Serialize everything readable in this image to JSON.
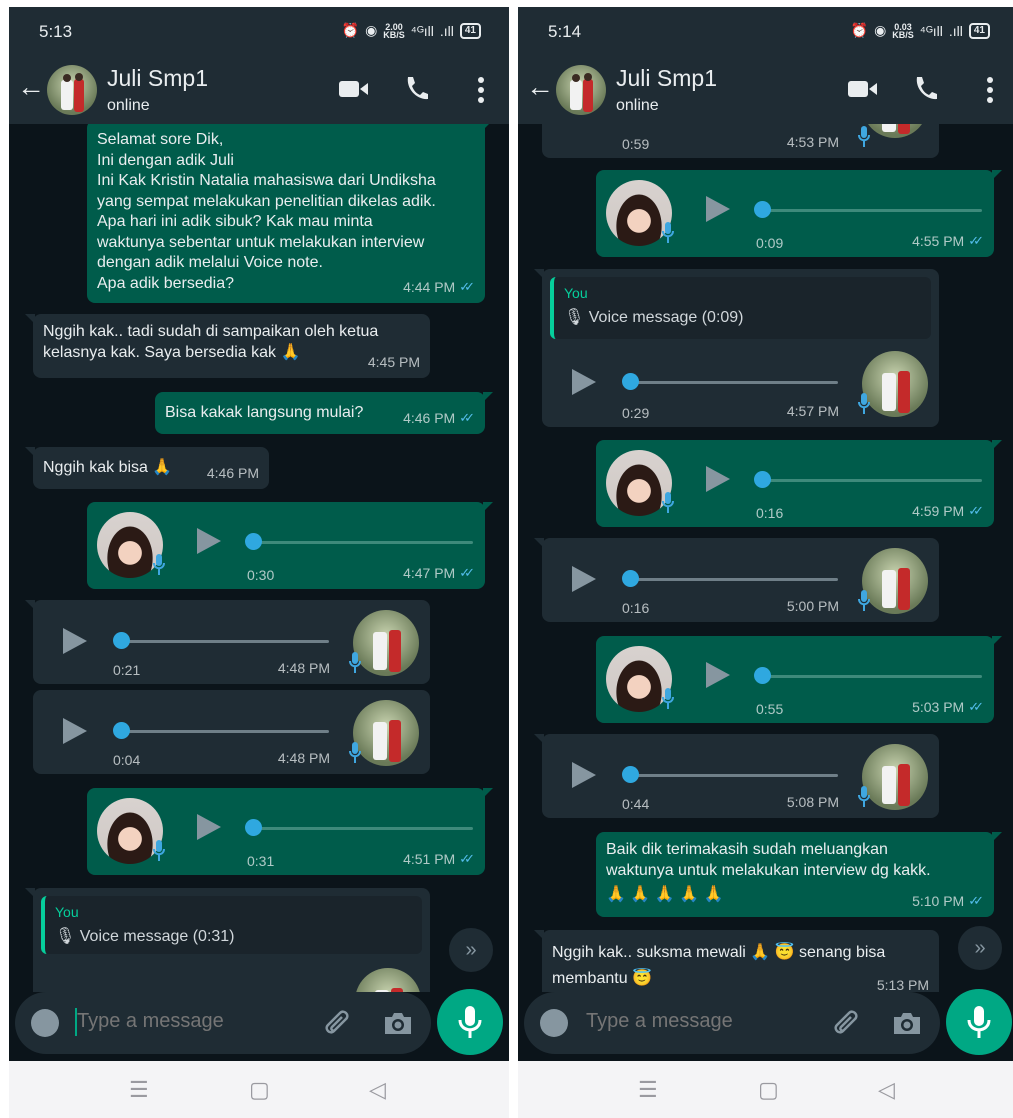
{
  "screens": [
    {
      "status": {
        "time": "5:13",
        "speed_top": "2.00",
        "speed_unit": "KB/S",
        "battery": "41"
      },
      "header": {
        "name": "Juli Smp1",
        "status": "online"
      },
      "messages": [
        {
          "type": "text",
          "dir": "out",
          "lines": [
            "Selamat sore Dik,",
            "Ini dengan adik Juli",
            "Ini Kak Kristin Natalia mahasiswa dari Undiksha",
            "yang sempat melakukan penelitian dikelas adik.",
            "Apa hari ini adik sibuk? Kak mau minta",
            "waktunya sebentar untuk melakukan interview",
            "dengan adik melalui Voice note.",
            "Apa adik bersedia?"
          ],
          "time": "4:44 PM"
        },
        {
          "type": "text",
          "dir": "in",
          "lines": [
            "Nggih kak.. tadi sudah di sampaikan oleh ketua",
            "kelasnya kak. Saya bersedia kak 🙏"
          ],
          "time": "4:45 PM"
        },
        {
          "type": "text",
          "dir": "out",
          "lines": [
            "Bisa kakak langsung mulai?"
          ],
          "time": "4:46 PM"
        },
        {
          "type": "text",
          "dir": "in",
          "lines": [
            "Nggih kak bisa 🙏"
          ],
          "time": "4:46 PM"
        },
        {
          "type": "voice",
          "dir": "out",
          "duration": "0:30",
          "time": "4:47 PM"
        },
        {
          "type": "voice",
          "dir": "in",
          "duration": "0:21",
          "time": "4:48 PM"
        },
        {
          "type": "voice",
          "dir": "in",
          "duration": "0:04",
          "time": "4:48 PM"
        },
        {
          "type": "voice",
          "dir": "out",
          "duration": "0:31",
          "time": "4:51 PM"
        },
        {
          "type": "reply",
          "dir": "in",
          "quote_author": "You",
          "quote_text": "🎙 Voice message (0:31)"
        }
      ],
      "composer_placeholder": "Type a message"
    },
    {
      "status": {
        "time": "5:14",
        "speed_top": "0.03",
        "speed_unit": "KB/S",
        "battery": "41"
      },
      "header": {
        "name": "Juli Smp1",
        "status": "online"
      },
      "messages": [
        {
          "type": "voice",
          "dir": "in",
          "duration": "0:59",
          "time": "4:53 PM"
        },
        {
          "type": "voice",
          "dir": "out",
          "duration": "0:09",
          "time": "4:55 PM"
        },
        {
          "type": "reply-voice",
          "dir": "in",
          "quote_author": "You",
          "quote_text": "🎙 Voice message (0:09)",
          "duration": "0:29",
          "time": "4:57 PM"
        },
        {
          "type": "voice",
          "dir": "out",
          "duration": "0:16",
          "time": "4:59 PM"
        },
        {
          "type": "voice",
          "dir": "in",
          "duration": "0:16",
          "time": "5:00 PM"
        },
        {
          "type": "voice",
          "dir": "out",
          "duration": "0:55",
          "time": "5:03 PM"
        },
        {
          "type": "voice",
          "dir": "in",
          "duration": "0:44",
          "time": "5:08 PM"
        },
        {
          "type": "text",
          "dir": "out",
          "lines": [
            "Baik dik terimakasih sudah meluangkan",
            "waktunya untuk melakukan interview dg kakk.",
            "🙏 🙏 🙏 🙏 🙏"
          ],
          "time": "5:10 PM"
        },
        {
          "type": "text",
          "dir": "in",
          "lines": [
            "Nggih kak.. suksma mewali 🙏 😇 senang bisa",
            "membantu 😇"
          ],
          "time": "5:13 PM"
        }
      ],
      "composer_placeholder": "Type a message"
    }
  ],
  "icons": {
    "back": "arrow-left-icon",
    "video": "video-call-icon",
    "call": "phone-call-icon",
    "more": "more-vertical-icon",
    "emoji": "emoji-icon",
    "attach": "paperclip-icon",
    "camera": "camera-icon",
    "mic": "microphone-icon",
    "scroll": "double-chevron-down-icon"
  },
  "colors": {
    "background": "#0b141a",
    "header": "#1f2c34",
    "outgoing_bubble": "#005c4b",
    "incoming_bubble": "#1f2c34",
    "accent": "#00a884",
    "read_ticks": "#53bdeb",
    "voice_knob": "#2fa8e0"
  }
}
